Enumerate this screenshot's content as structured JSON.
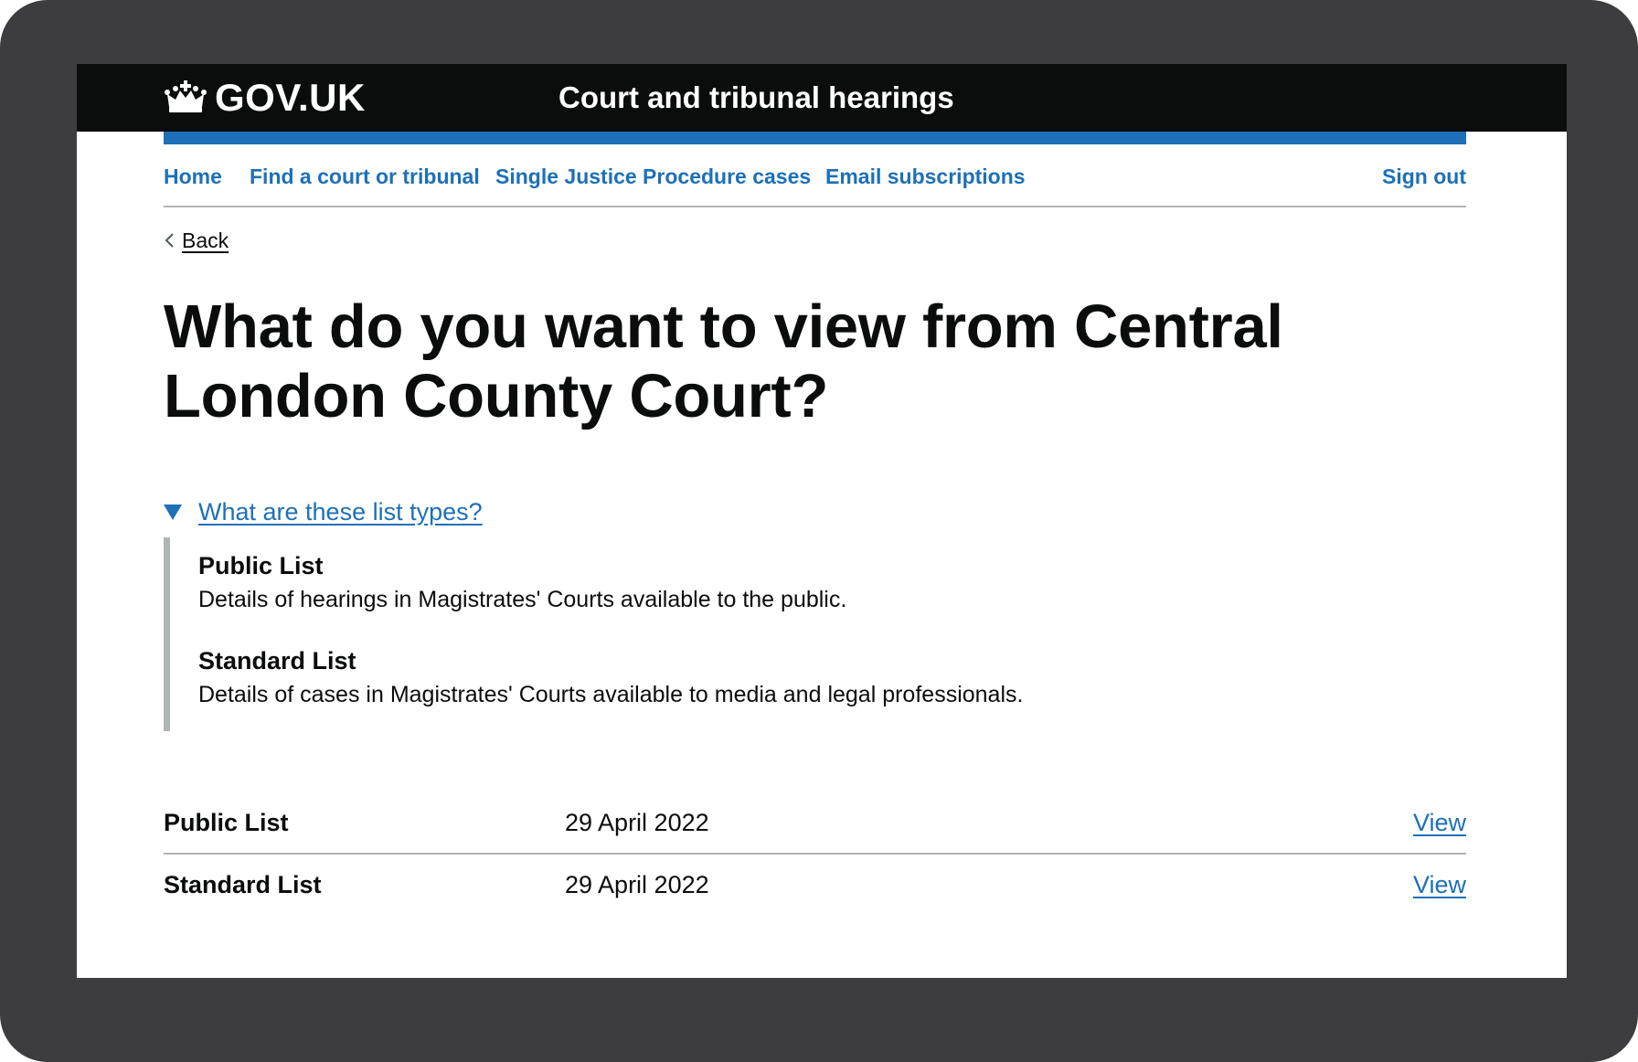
{
  "header": {
    "logo_text": "GOV.UK",
    "service_name": "Court and tribunal hearings"
  },
  "nav": {
    "items": [
      {
        "label": "Home"
      },
      {
        "label": "Find a court or tribunal"
      },
      {
        "label": "Single Justice Procedure cases"
      },
      {
        "label": "Email subscriptions"
      }
    ],
    "sign_out": "Sign out"
  },
  "back_link": "Back",
  "page_title": "What do you want to view from Central London County Court?",
  "details": {
    "summary": "What are these list types?",
    "items": [
      {
        "term": "Public List",
        "description": "Details of hearings in Magistrates' Courts available to the public."
      },
      {
        "term": "Standard List",
        "description": "Details of cases in Magistrates' Courts available to media and legal professionals."
      }
    ]
  },
  "lists": [
    {
      "name": "Public List",
      "date": "29 April 2022",
      "action": "View"
    },
    {
      "name": "Standard List",
      "date": "29 April 2022",
      "action": "View"
    }
  ],
  "colors": {
    "header_bg": "#0b0c0c",
    "link": "#1d70b8",
    "border": "#b1b4b6",
    "text": "#0b0c0c"
  }
}
